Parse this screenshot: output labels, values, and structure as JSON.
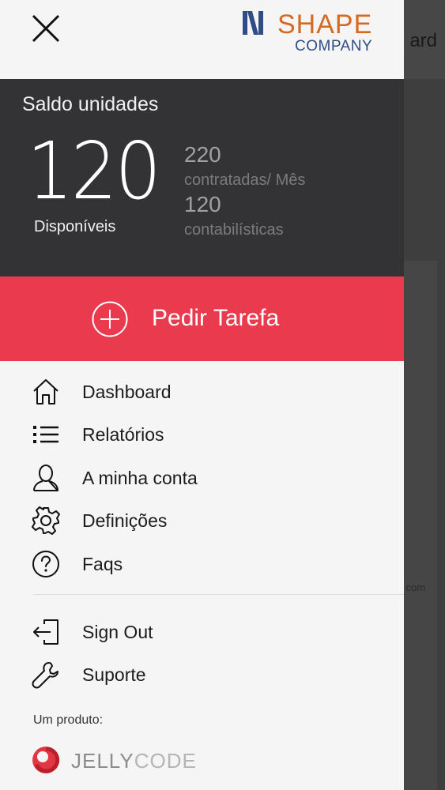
{
  "background": {
    "title_fragment": "ard",
    "small_fragment": "com"
  },
  "header": {
    "logo_word": "SHAPE",
    "logo_sub": "COMPANY"
  },
  "balance": {
    "title": "Saldo unidades",
    "available_value": "120",
    "available_label": "Disponíveis",
    "contracted_value": "220",
    "contracted_label": "contratadas/  Mês",
    "accounting_value": "120",
    "accounting_label": "contabilísticas"
  },
  "request_button": {
    "label": "Pedir Tarefa"
  },
  "menu": [
    {
      "label": "Dashboard",
      "icon": "home-icon"
    },
    {
      "label": "Relatórios",
      "icon": "list-icon"
    },
    {
      "label": "A minha conta",
      "icon": "user-icon"
    },
    {
      "label": "Definições",
      "icon": "gear-icon"
    },
    {
      "label": "Faqs",
      "icon": "question-icon"
    }
  ],
  "secondary_menu": [
    {
      "label": "Sign Out",
      "icon": "sign-out-icon"
    },
    {
      "label": "Suporte",
      "icon": "wrench-icon"
    }
  ],
  "footer": {
    "product_label": "Um produto:",
    "brand_part1": "JELLY",
    "brand_part2": "CODE"
  },
  "colors": {
    "accent": "#e93b4d",
    "dark_panel": "#333335",
    "logo_orange": "#d5691f",
    "logo_blue": "#2f4c85"
  }
}
